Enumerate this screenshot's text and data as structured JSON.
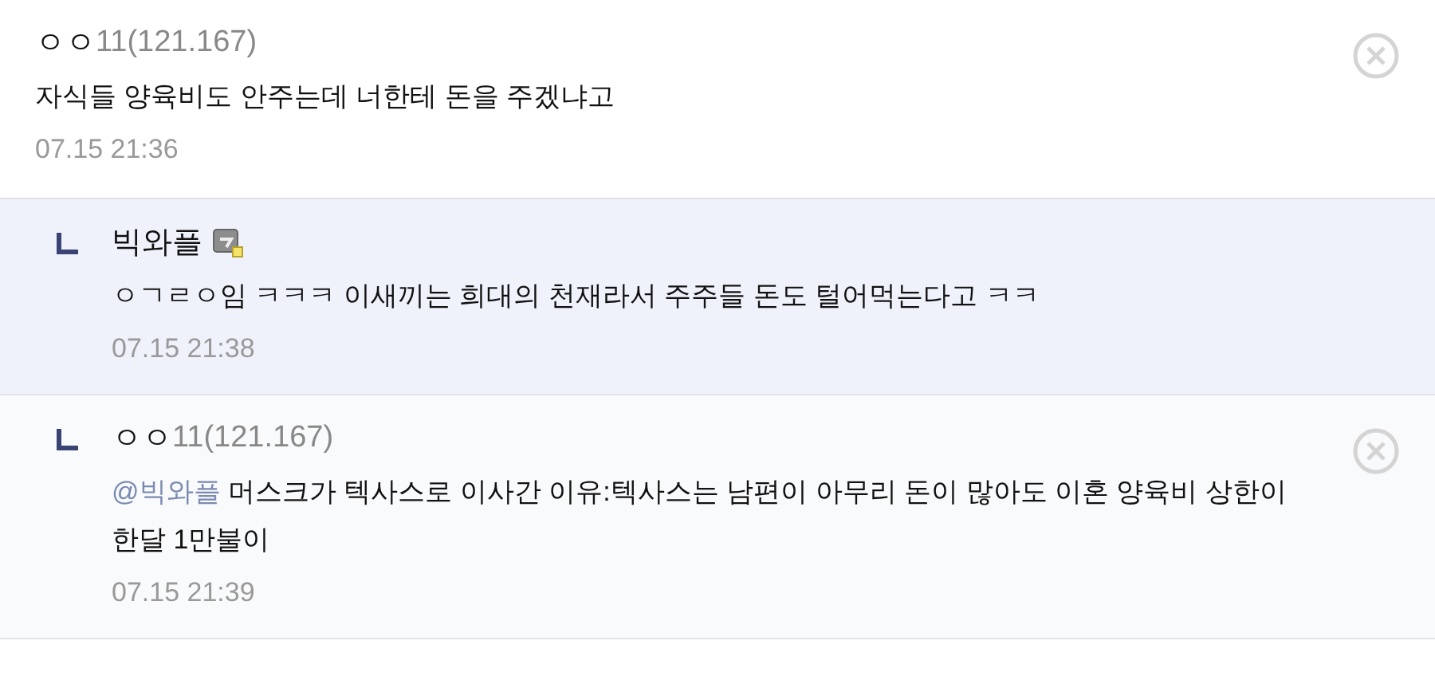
{
  "comments": [
    {
      "kind": "comment",
      "name": "ㅇㅇ",
      "ip": "11(121.167)",
      "member_icon": false,
      "text": "자식들 양육비도 안주는데 너한테 돈을 주겠냐고",
      "time": "07.15 21:36",
      "deletable": true,
      "highlighted": false
    },
    {
      "kind": "reply",
      "name": "빅와플",
      "member_icon": true,
      "text": "ㅇㄱㄹㅇ임 ㅋㅋㅋ 이새끼는 희대의 천재라서 주주들 돈도 털어먹는다고 ㅋㅋ",
      "time": "07.15 21:38",
      "deletable": false,
      "highlighted": true
    },
    {
      "kind": "reply",
      "name": "ㅇㅇ",
      "ip": "11(121.167)",
      "member_icon": false,
      "mention": "@빅와플",
      "text": "머스크가 텍사스로 이사간 이유:텍사스는 남편이 아무리 돈이 많아도 이혼 양육비 상한이 한달 1만불이",
      "time": "07.15 21:39",
      "deletable": true,
      "highlighted": false
    }
  ]
}
